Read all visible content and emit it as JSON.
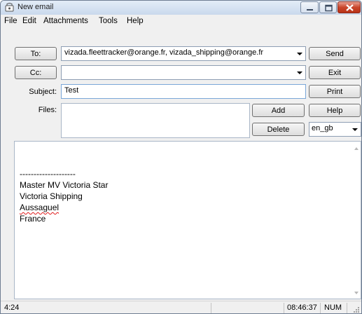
{
  "window": {
    "title": "New email"
  },
  "menu": [
    "File",
    "Edit",
    "Attachments",
    "Tools",
    "Help"
  ],
  "to": {
    "button_label": "To:",
    "value": "vizada.fleettracker@orange.fr, vizada_shipping@orange.fr"
  },
  "cc": {
    "button_label": "Cc:",
    "value": ""
  },
  "subject": {
    "label": "Subject:",
    "value": "Test"
  },
  "files": {
    "label": "Files:",
    "add_label": "Add",
    "delete_label": "Delete"
  },
  "actions": {
    "send": "Send",
    "exit": "Exit",
    "print": "Print",
    "help": "Help"
  },
  "language": {
    "selected": "en_gb"
  },
  "body": {
    "lines": [
      "--------------------",
      "Master MV Victoria Star",
      "Victoria Shipping",
      "Aussaguel",
      "France"
    ]
  },
  "status": {
    "cursor": "4:24",
    "time": "08:46:37",
    "mode": "NUM"
  }
}
